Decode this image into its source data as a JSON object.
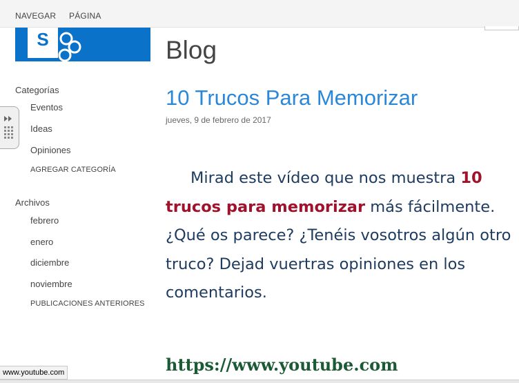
{
  "ribbon": {
    "tabs": [
      "NAVEGAR",
      "PÁGINA"
    ]
  },
  "logo": {
    "icon": "sharepoint-logo-icon",
    "color": "#0a72c9",
    "letter": "S"
  },
  "nav": {
    "categories_heading": "Categorías",
    "categories": [
      "Eventos",
      "Ideas",
      "Opiniones"
    ],
    "add_category": "AGREGAR CATEGORÍA",
    "archives_heading": "Archivos",
    "archives": [
      "febrero",
      "enero",
      "diciembre",
      "noviembre"
    ],
    "older_posts": "PUBLICACIONES ANTERIORES"
  },
  "page": {
    "title": "Blog"
  },
  "post": {
    "title": "10 Trucos Para Memorizar",
    "date": "jueves, 9 de febrero de 2017",
    "body_before": "Mirad este vídeo que nos muestra ",
    "body_highlight": "10 trucos para memorizar",
    "body_after": " más fácilmente. ¿Qué os parece? ¿Tenéis vosotros algún otro truco? Dejad vuertras opiniones en los comentarios.",
    "link": "https://www.youtube.com"
  },
  "status": {
    "url": "www.youtube.com"
  },
  "colors": {
    "accent_blue": "#2b88d8",
    "highlight_red": "#a0122c",
    "body_navy": "#1e3c60",
    "link_green": "#1c5a35"
  }
}
